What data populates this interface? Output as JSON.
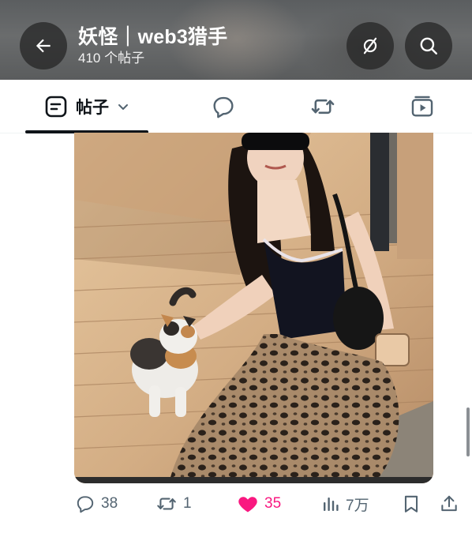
{
  "header": {
    "title": "妖怪｜web3猎手",
    "subtitle": "410 个帖子",
    "back_icon": "arrow-left-icon",
    "noimage_icon": "no-image-icon",
    "search_icon": "search-icon"
  },
  "tabs": [
    {
      "label": "帖子",
      "icon": "posts-icon",
      "active": true
    },
    {
      "label": "",
      "icon": "reply-bubble-icon"
    },
    {
      "label": "",
      "icon": "repost-icon"
    },
    {
      "label": "",
      "icon": "media-icon"
    }
  ],
  "post": {
    "stats": {
      "replies": "38",
      "reposts": "1",
      "likes": "35",
      "views": "7万"
    },
    "liked": true
  },
  "colors": {
    "like_active": "#f91880",
    "icon_gray": "#536471",
    "text_primary": "#0f1419"
  }
}
